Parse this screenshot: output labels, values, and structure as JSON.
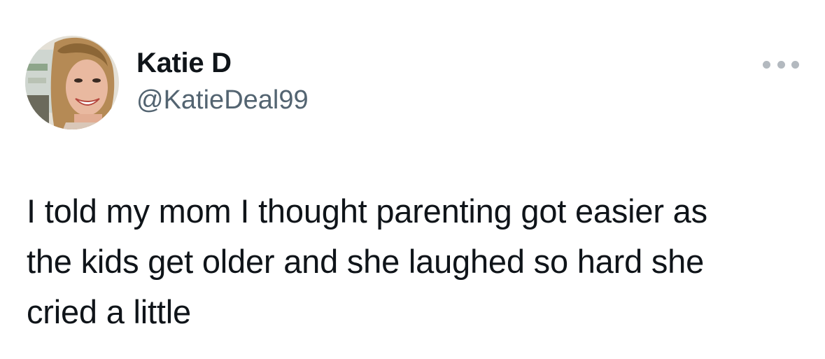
{
  "author": {
    "display_name": "Katie D",
    "handle": "@KatieDeal99",
    "avatar": "profile-photo"
  },
  "tweet": {
    "text": "I told my mom I thought parenting got easier as\nthe kids get older and she laughed so hard she\ncried a little"
  },
  "icons": {
    "more": "more-options-icon"
  },
  "colors": {
    "text_primary": "#0f1419",
    "text_secondary": "#536471",
    "more_dots": "#b3b9bf"
  }
}
